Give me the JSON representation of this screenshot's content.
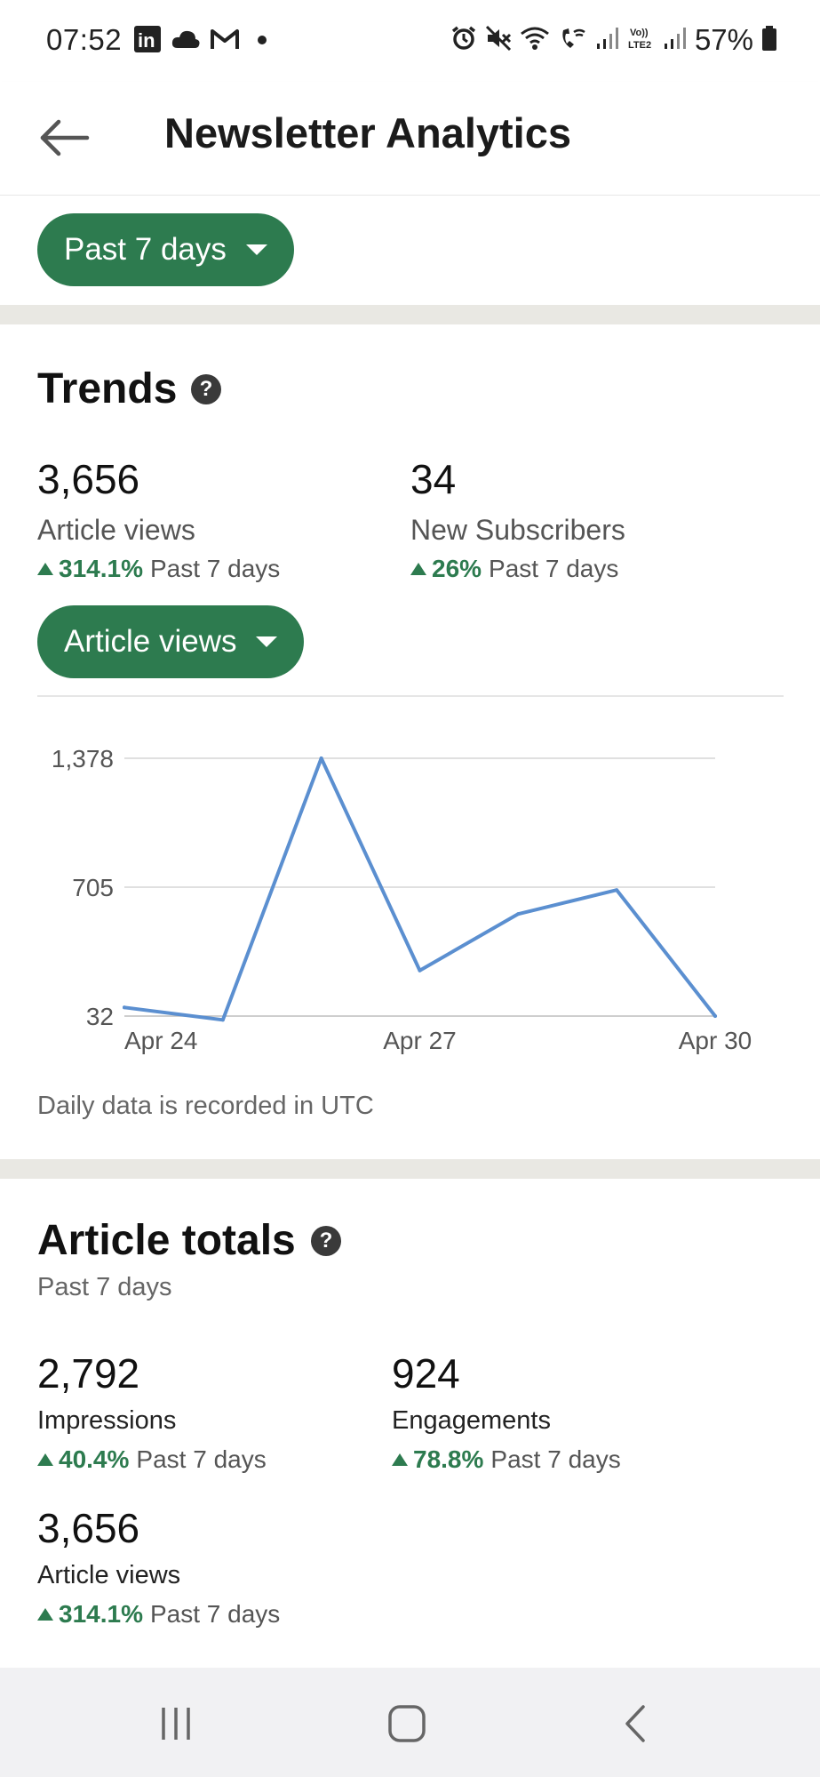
{
  "status_bar": {
    "time": "07:52",
    "battery": "57%",
    "left_icons": [
      "linkedin-icon",
      "cloud-icon",
      "gmail-icon",
      "dot-icon"
    ],
    "right_icons": [
      "alarm-icon",
      "mute-icon",
      "wifi-icon",
      "wifi-call-icon",
      "signal-icon",
      "volte-icon",
      "signal-icon",
      "battery-icon"
    ]
  },
  "app_bar": {
    "title": "Newsletter Analytics",
    "back_icon": "arrow-left-icon"
  },
  "filter": {
    "label": "Past 7 days"
  },
  "trends": {
    "title": "Trends",
    "metrics": [
      {
        "value": "3,656",
        "label": "Article views",
        "change": "314.1%",
        "period": "Past 7 days"
      },
      {
        "value": "34",
        "label": "New Subscribers",
        "change": "26%",
        "period": "Past 7 days"
      }
    ],
    "selector_label": "Article views",
    "note": "Daily data is recorded in UTC"
  },
  "chart_data": {
    "type": "line",
    "x": [
      "Apr 24",
      "Apr 25",
      "Apr 26",
      "Apr 27",
      "Apr 28",
      "Apr 29",
      "Apr 30"
    ],
    "y": [
      77,
      0,
      1378,
      270,
      565,
      690,
      32
    ],
    "ylim": [
      32,
      1378
    ],
    "ytick_labels": [
      "1,378",
      "705",
      "32"
    ],
    "xtick_labels": [
      "Apr 24",
      "Apr 27",
      "Apr 30"
    ],
    "title": "",
    "xlabel": "",
    "ylabel": "",
    "color": "#5b8fd0",
    "grid": true
  },
  "article_totals": {
    "title": "Article totals",
    "subtitle": "Past 7 days",
    "metrics": [
      {
        "value": "2,792",
        "label": "Impressions",
        "change": "40.4%",
        "period": "Past 7 days"
      },
      {
        "value": "924",
        "label": "Engagements",
        "change": "78.8%",
        "period": "Past 7 days"
      },
      {
        "value": "3,656",
        "label": "Article views",
        "change": "314.1%",
        "period": "Past 7 days"
      }
    ]
  },
  "colors": {
    "accent": "#2d7b4f",
    "line": "#5b8fd0",
    "band": "#e9e8e3"
  },
  "nav_bar": {
    "icons": [
      "recents-icon",
      "home-icon",
      "back-icon"
    ]
  }
}
